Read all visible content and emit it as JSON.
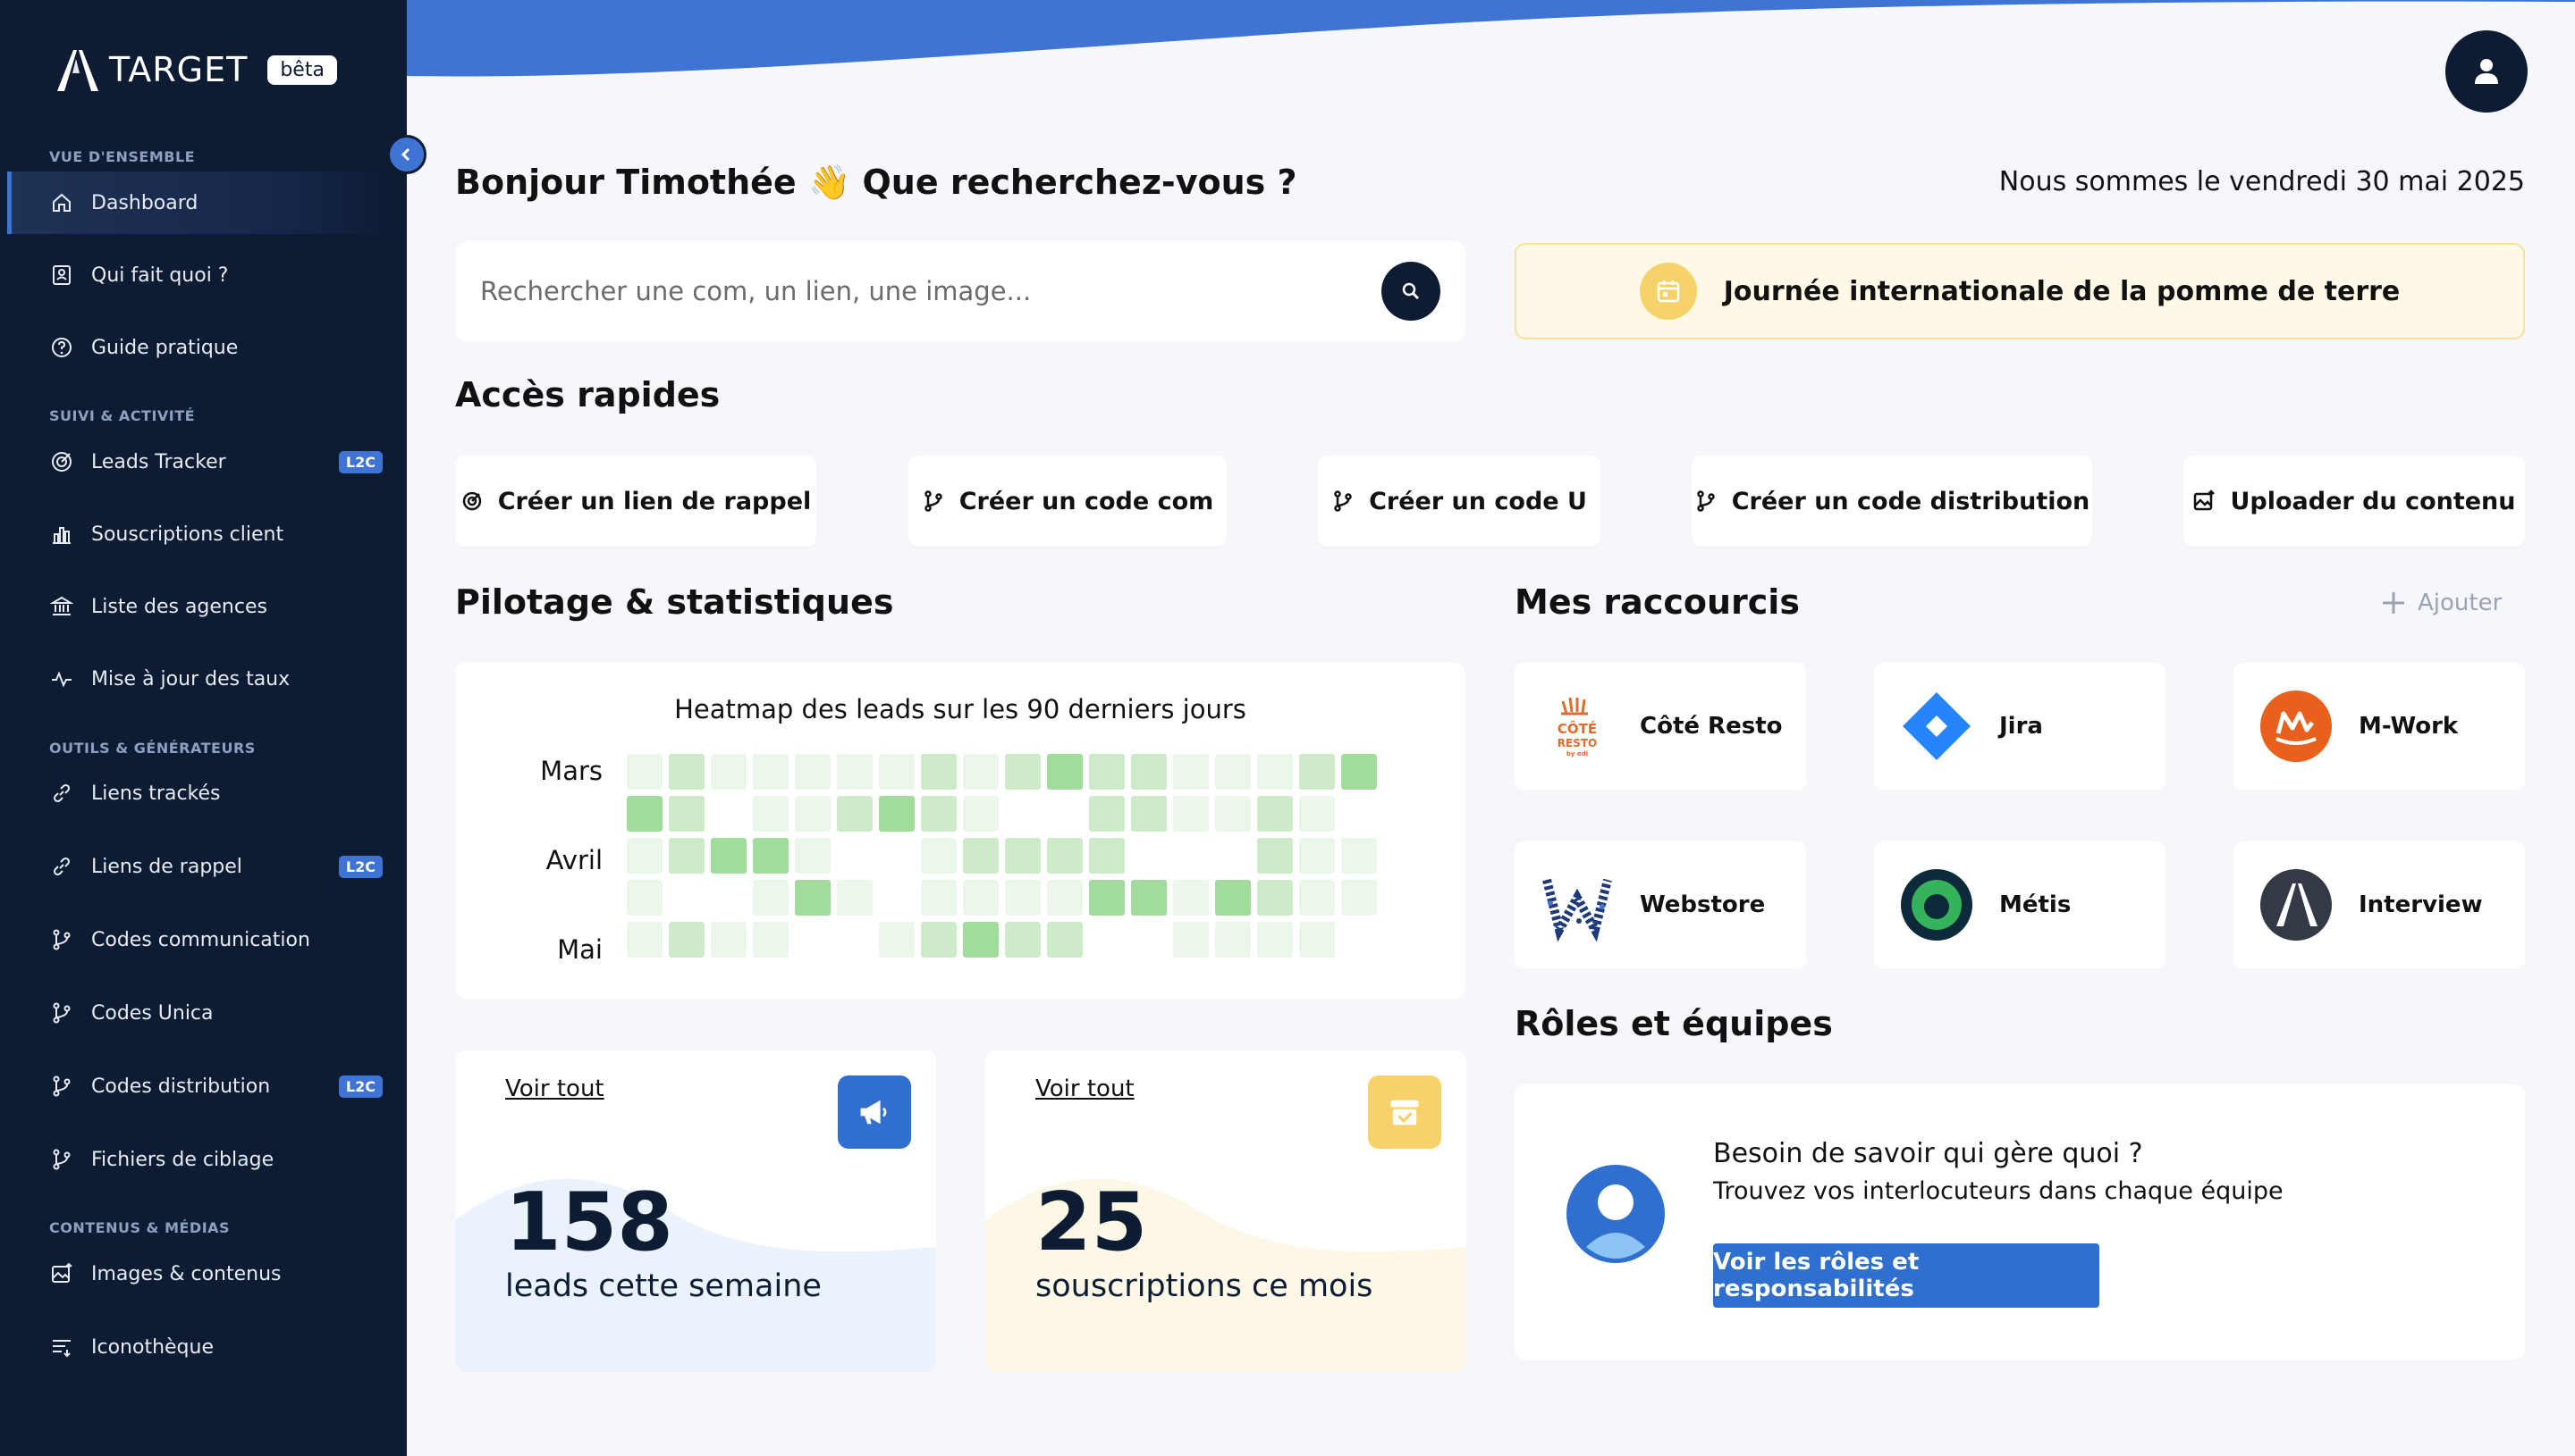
{
  "sidebar": {
    "logo_text": "TARGET",
    "beta": "bêta",
    "sections": {
      "overview": "VUE D'ENSEMBLE",
      "activity": "SUIVI & ACTIVITÉ",
      "tools": "OUTILS & GÉNÉRATEURS",
      "content": "CONTENUS & MÉDIAS"
    },
    "items": {
      "dashboard": "Dashboard",
      "who": "Qui fait quoi ?",
      "guide": "Guide pratique",
      "leads": "Leads Tracker",
      "subs": "Souscriptions client",
      "agencies": "Liste des agences",
      "rates": "Mise à jour des taux",
      "tracked": "Liens trackés",
      "reminder": "Liens de rappel",
      "codes_com": "Codes communication",
      "codes_unica": "Codes Unica",
      "codes_dist": "Codes distribution",
      "targeting": "Fichiers de ciblage",
      "images": "Images & contenus",
      "icons": "Iconothèque"
    },
    "badge": "L2C"
  },
  "header": {
    "greeting_name": "Bonjour Timothée",
    "greeting_emoji": "👋",
    "greeting_question": "Que recherchez-vous ?",
    "date": "Nous sommes le vendredi 30 mai 2025"
  },
  "search": {
    "placeholder": "Rechercher une com, un lien, une image..."
  },
  "event": {
    "label": "Journée internationale de la pomme de terre"
  },
  "quick_access": {
    "title": "Accès rapides",
    "items": [
      "Créer un lien de rappel",
      "Créer un code com",
      "Créer un code U",
      "Créer un code distribution",
      "Uploader du contenu"
    ]
  },
  "stats": {
    "title": "Pilotage & statistiques",
    "heatmap_title": "Heatmap des leads sur les 90 derniers jours",
    "months": [
      "Mars",
      "Avril",
      "Mai"
    ],
    "heatmap_levels": [
      [
        1,
        2,
        1,
        1,
        1,
        1,
        1,
        2,
        1,
        2,
        3,
        2,
        2,
        1,
        1,
        1,
        2,
        3
      ],
      [
        3,
        2,
        0,
        1,
        1,
        2,
        3,
        2,
        1,
        0,
        0,
        2,
        2,
        1,
        1,
        2,
        1,
        0
      ],
      [
        1,
        2,
        3,
        3,
        1,
        0,
        0,
        1,
        2,
        2,
        2,
        2,
        0,
        0,
        0,
        2,
        1,
        1
      ],
      [
        1,
        0,
        0,
        1,
        3,
        1,
        0,
        1,
        1,
        1,
        1,
        3,
        3,
        1,
        3,
        2,
        1,
        1
      ],
      [
        1,
        2,
        1,
        1,
        0,
        0,
        1,
        2,
        3,
        2,
        2,
        0,
        0,
        1,
        1,
        1,
        1,
        0
      ]
    ],
    "colors": [
      "#ebf7ea",
      "#cdeac9",
      "#a2dc9c",
      "#4cb84a"
    ],
    "card1": {
      "see_all": "Voir tout",
      "value": "158",
      "label": "leads cette semaine"
    },
    "card2": {
      "see_all": "Voir tout",
      "value": "25",
      "label": "souscriptions ce mois"
    }
  },
  "shortcuts": {
    "title": "Mes raccourcis",
    "add": "Ajouter",
    "items": [
      "Côté Resto",
      "Jira",
      "M-Work",
      "Webstore",
      "Métis",
      "Interview"
    ],
    "cote_logo_top": "CÔTÉ",
    "cote_logo_bottom": "RESTO",
    "cote_logo_sub": "by edi"
  },
  "roles": {
    "title": "Rôles et équipes",
    "question": "Besoin de savoir qui gère quoi ?",
    "sub": "Trouvez vos interlocuteurs dans chaque équipe",
    "button": "Voir les rôles et responsabilités"
  }
}
